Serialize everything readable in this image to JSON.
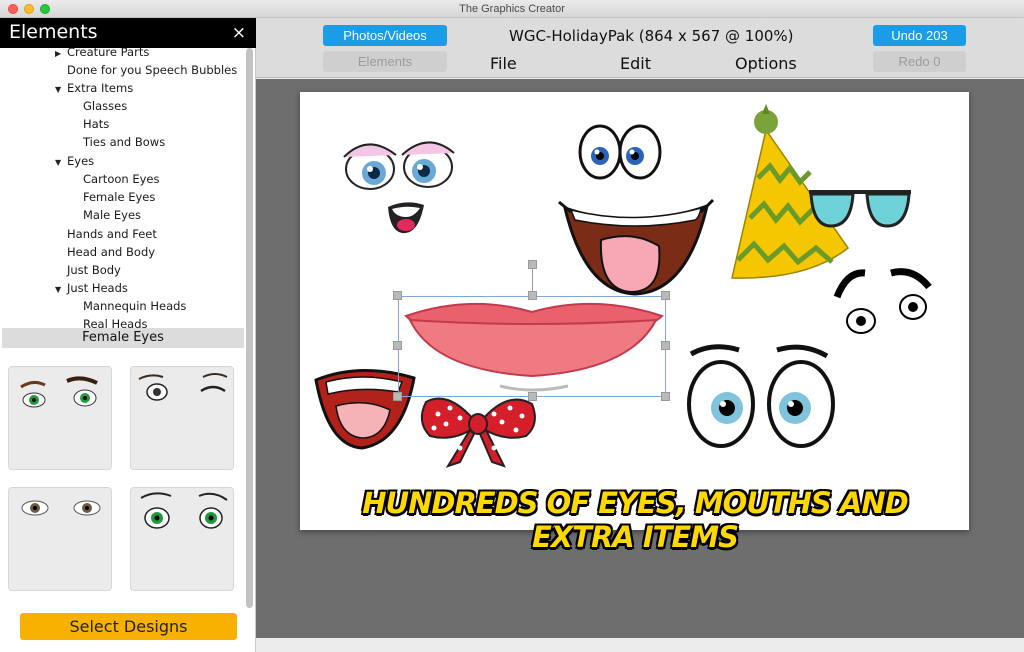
{
  "window": {
    "title": "The Graphics Creator"
  },
  "sidebar": {
    "title": "Elements",
    "close_glyph": "×",
    "tree": [
      {
        "label": "Creature Parts",
        "level": 1,
        "expanded": false
      },
      {
        "label": "Done for you Speech Bubbles",
        "level": 1
      },
      {
        "label": "Extra Items",
        "level": 1,
        "expanded": true
      },
      {
        "label": "Glasses",
        "level": 2
      },
      {
        "label": "Hats",
        "level": 2
      },
      {
        "label": "Ties and Bows",
        "level": 2
      },
      {
        "label": "Eyes",
        "level": 1,
        "expanded": true
      },
      {
        "label": "Cartoon Eyes",
        "level": 2
      },
      {
        "label": "Female Eyes",
        "level": 2
      },
      {
        "label": "Male Eyes",
        "level": 2
      },
      {
        "label": "Hands and Feet",
        "level": 1
      },
      {
        "label": "Head and Body",
        "level": 1
      },
      {
        "label": "Just Body",
        "level": 1
      },
      {
        "label": "Just Heads",
        "level": 1,
        "expanded": true
      },
      {
        "label": "Mannequin Heads",
        "level": 2
      },
      {
        "label": "Real Heads",
        "level": 2
      }
    ],
    "selected_category": "Female Eyes",
    "select_button": "Select Designs",
    "accent_color": "#f8b100"
  },
  "toolbar": {
    "photos_button": "Photos/Videos",
    "elements_button": "Elements",
    "document_title": "WGC-HolidayPak (864 x 567 @ 100%)",
    "undo_button": "Undo 203",
    "redo_button": "Redo 0",
    "menu": [
      "File",
      "Edit",
      "Options"
    ],
    "button_color": "#1a9ce6"
  },
  "canvas": {
    "banner_text": "HUNDREDS OF EYES, MOUTHS AND EXTRA ITEMS",
    "banner_color": "#ffd800"
  },
  "icons": {
    "close": "close-icon",
    "expand": "triangle-down-icon",
    "collapsed": "triangle-right-icon"
  }
}
